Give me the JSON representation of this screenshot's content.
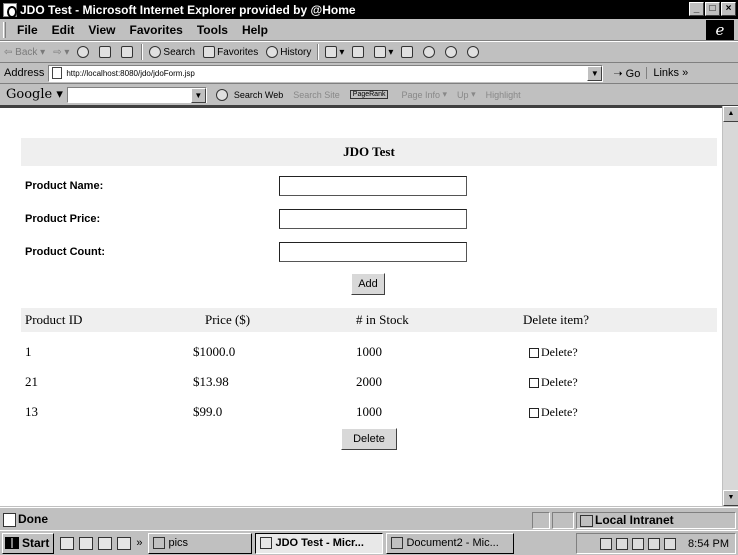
{
  "window": {
    "title": "JDO Test - Microsoft Internet Explorer provided by @Home",
    "controls": [
      "_",
      "□",
      "×"
    ]
  },
  "menu": [
    "File",
    "Edit",
    "View",
    "Favorites",
    "Tools",
    "Help"
  ],
  "toolbar": {
    "back": "⇦ Back",
    "forward": "⇨",
    "search": "Search",
    "favorites": "Favorites",
    "history": "History"
  },
  "address": {
    "label": "Address",
    "url": "http://localhost:8080/jdo/jdoForm.jsp",
    "go": "Go",
    "links": "Links »"
  },
  "google": {
    "logo": "Google",
    "search_web": "Search Web",
    "search_site": "Search Site",
    "pagerank": "PageRank",
    "page_info": "Page Info",
    "up": "Up",
    "highlight": "Highlight"
  },
  "form": {
    "heading": "JDO Test",
    "fields": [
      {
        "label": "Product Name:",
        "value": ""
      },
      {
        "label": "Product Price:",
        "value": ""
      },
      {
        "label": "Product Count:",
        "value": ""
      }
    ],
    "add_button": "Add"
  },
  "table": {
    "headers": [
      "Product ID",
      "Price ($)",
      "# in Stock",
      "Delete item?"
    ],
    "rows": [
      {
        "id": "1",
        "price": "$1000.0",
        "stock": "1000",
        "delete": "Delete?"
      },
      {
        "id": "21",
        "price": "$13.98",
        "stock": "2000",
        "delete": "Delete?"
      },
      {
        "id": "13",
        "price": "$99.0",
        "stock": "1000",
        "delete": "Delete?"
      }
    ],
    "delete_button": "Delete"
  },
  "status": {
    "text": "Done",
    "zone": "Local Intranet"
  },
  "taskbar": {
    "start": "Start",
    "quicklaunch_more": "»",
    "items": [
      "pics",
      "JDO Test - Micr...",
      "Document2 - Mic..."
    ],
    "clock": "8:54 PM"
  }
}
